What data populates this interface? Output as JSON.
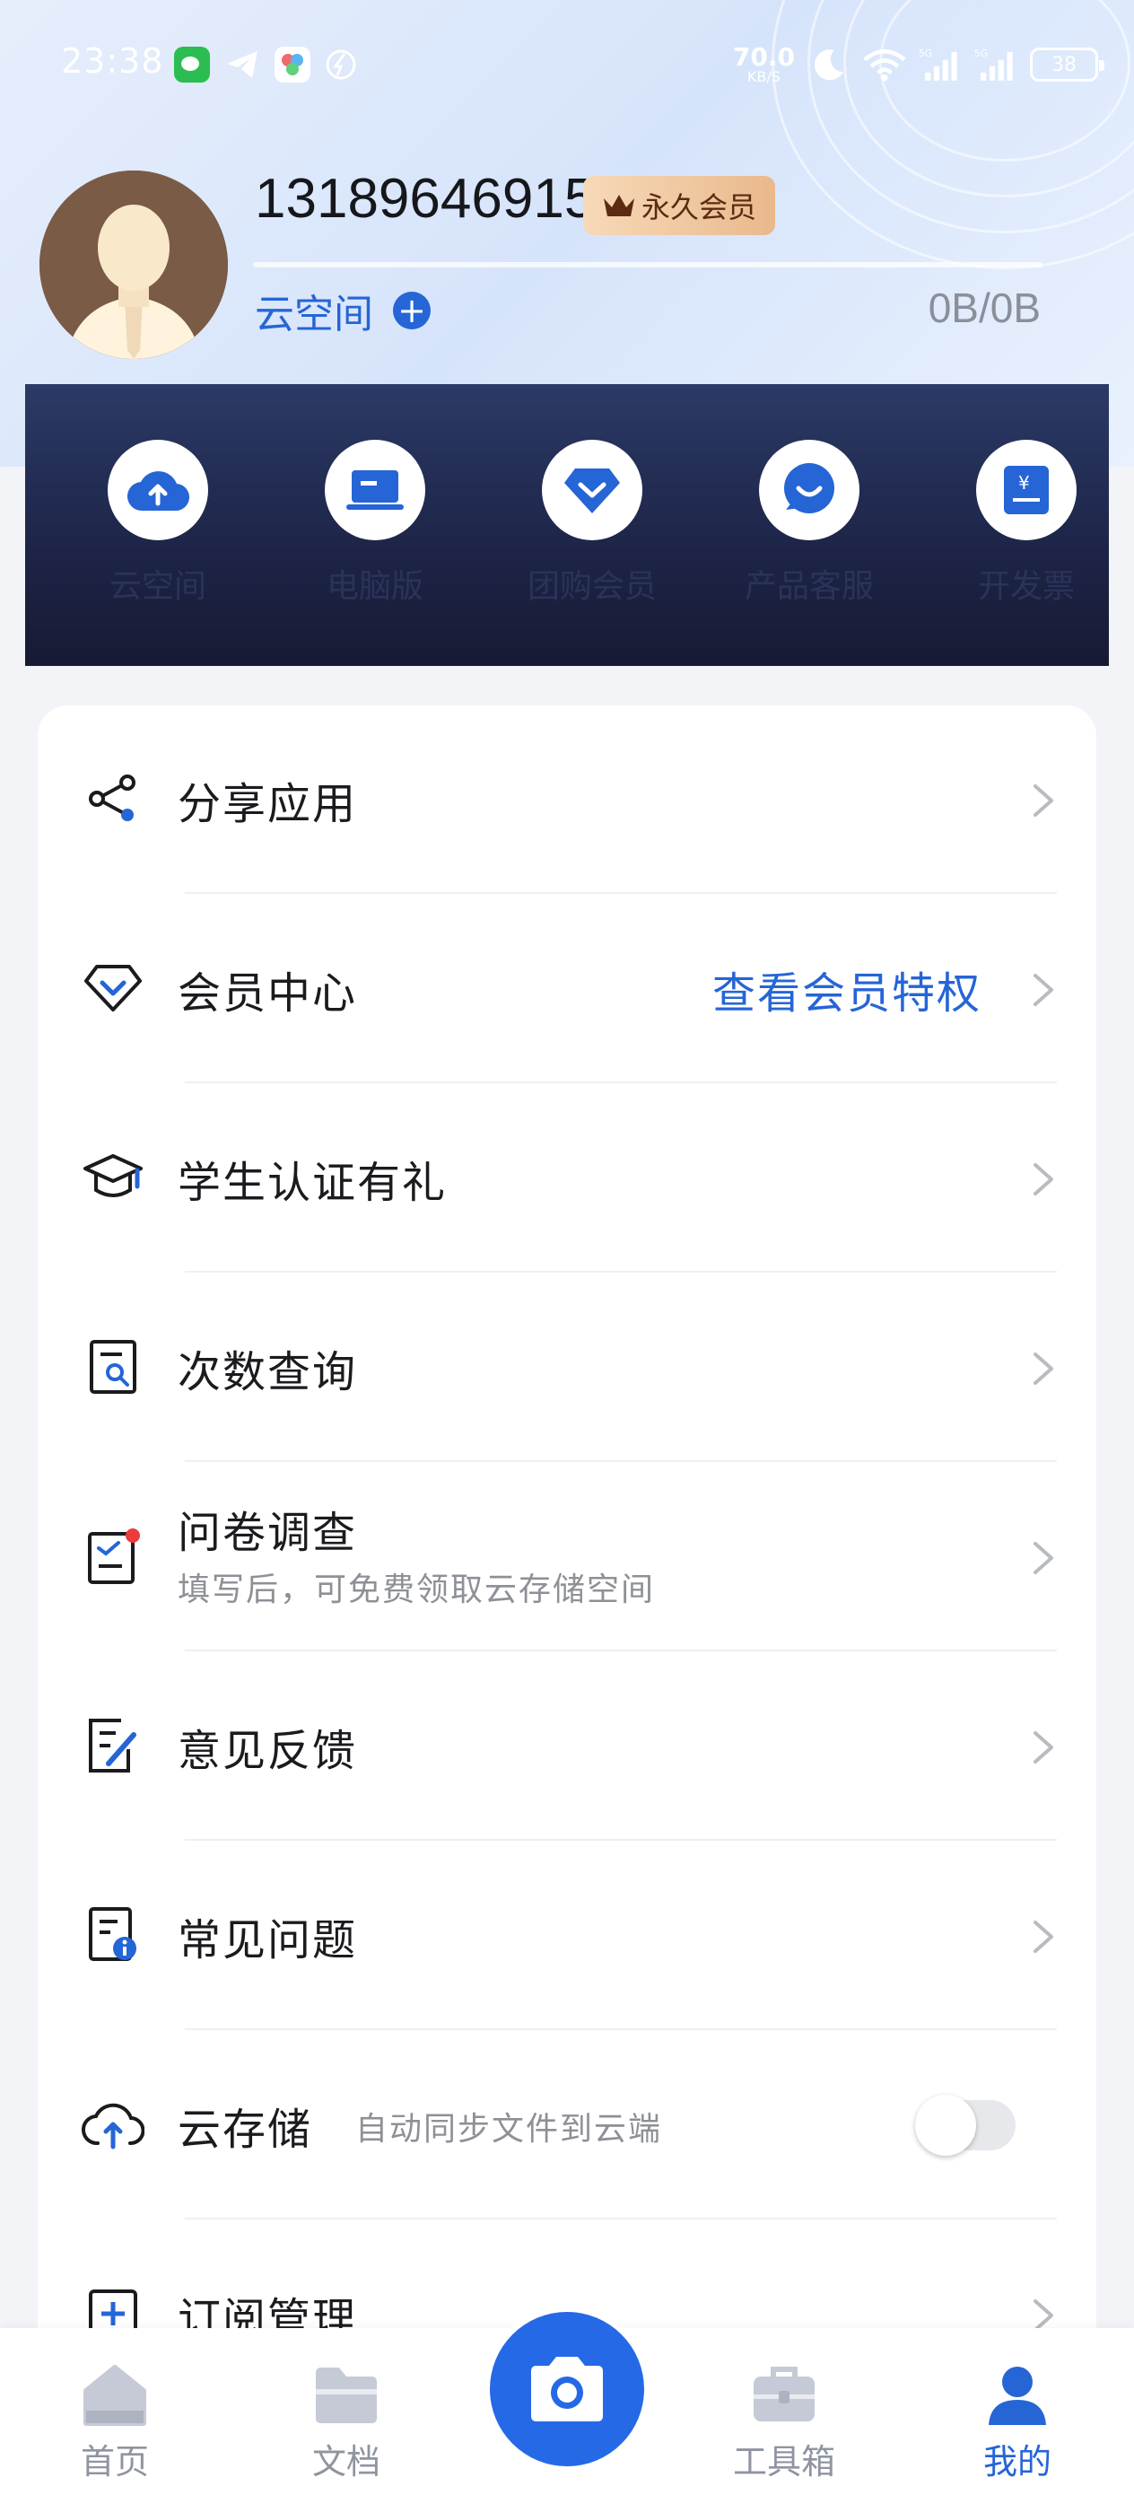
{
  "status_bar": {
    "time": "23:38",
    "speed_value": "70.0",
    "speed_unit": "KB/S",
    "battery": "38"
  },
  "profile": {
    "phone": "13189646915",
    "vip_badge": "永久会员",
    "cloud_space_label": "云空间",
    "storage": "0B/0B"
  },
  "shortcuts": [
    {
      "label": "云空间",
      "icon": "cloud-upload-icon"
    },
    {
      "label": "电脑版",
      "icon": "laptop-icon"
    },
    {
      "label": "团购会员",
      "icon": "diamond-icon"
    },
    {
      "label": "产品客服",
      "icon": "chat-smile-icon"
    },
    {
      "label": "开发票",
      "icon": "invoice-icon"
    }
  ],
  "menu": {
    "share": {
      "label": "分享应用",
      "icon": "share-icon"
    },
    "vip_center": {
      "label": "会员中心",
      "right": "查看会员特权",
      "icon": "diamond-outline-icon"
    },
    "student": {
      "label": "学生认证有礼",
      "icon": "graduation-cap-icon"
    },
    "usage": {
      "label": "次数查询",
      "icon": "search-doc-icon"
    },
    "survey": {
      "label": "问卷调查",
      "sub": "填写后，可免费领取云存储空间",
      "icon": "survey-icon"
    },
    "feedback": {
      "label": "意见反馈",
      "icon": "edit-icon"
    },
    "faq": {
      "label": "常见问题",
      "icon": "info-doc-icon"
    },
    "cloud_storage": {
      "label": "云存储",
      "sub": "自动同步文件到云端",
      "icon": "cloud-upload-outline-icon",
      "toggle_on": false
    },
    "subscription": {
      "label": "订阅管理",
      "icon": "subscription-icon"
    }
  },
  "bottom_nav": {
    "home": "首页",
    "docs": "文档",
    "toolbox": "工具箱",
    "mine": "我的"
  },
  "colors": {
    "accent": "#2565d6",
    "panel": "#1d2447",
    "vip_gold": "#e9b98c"
  }
}
